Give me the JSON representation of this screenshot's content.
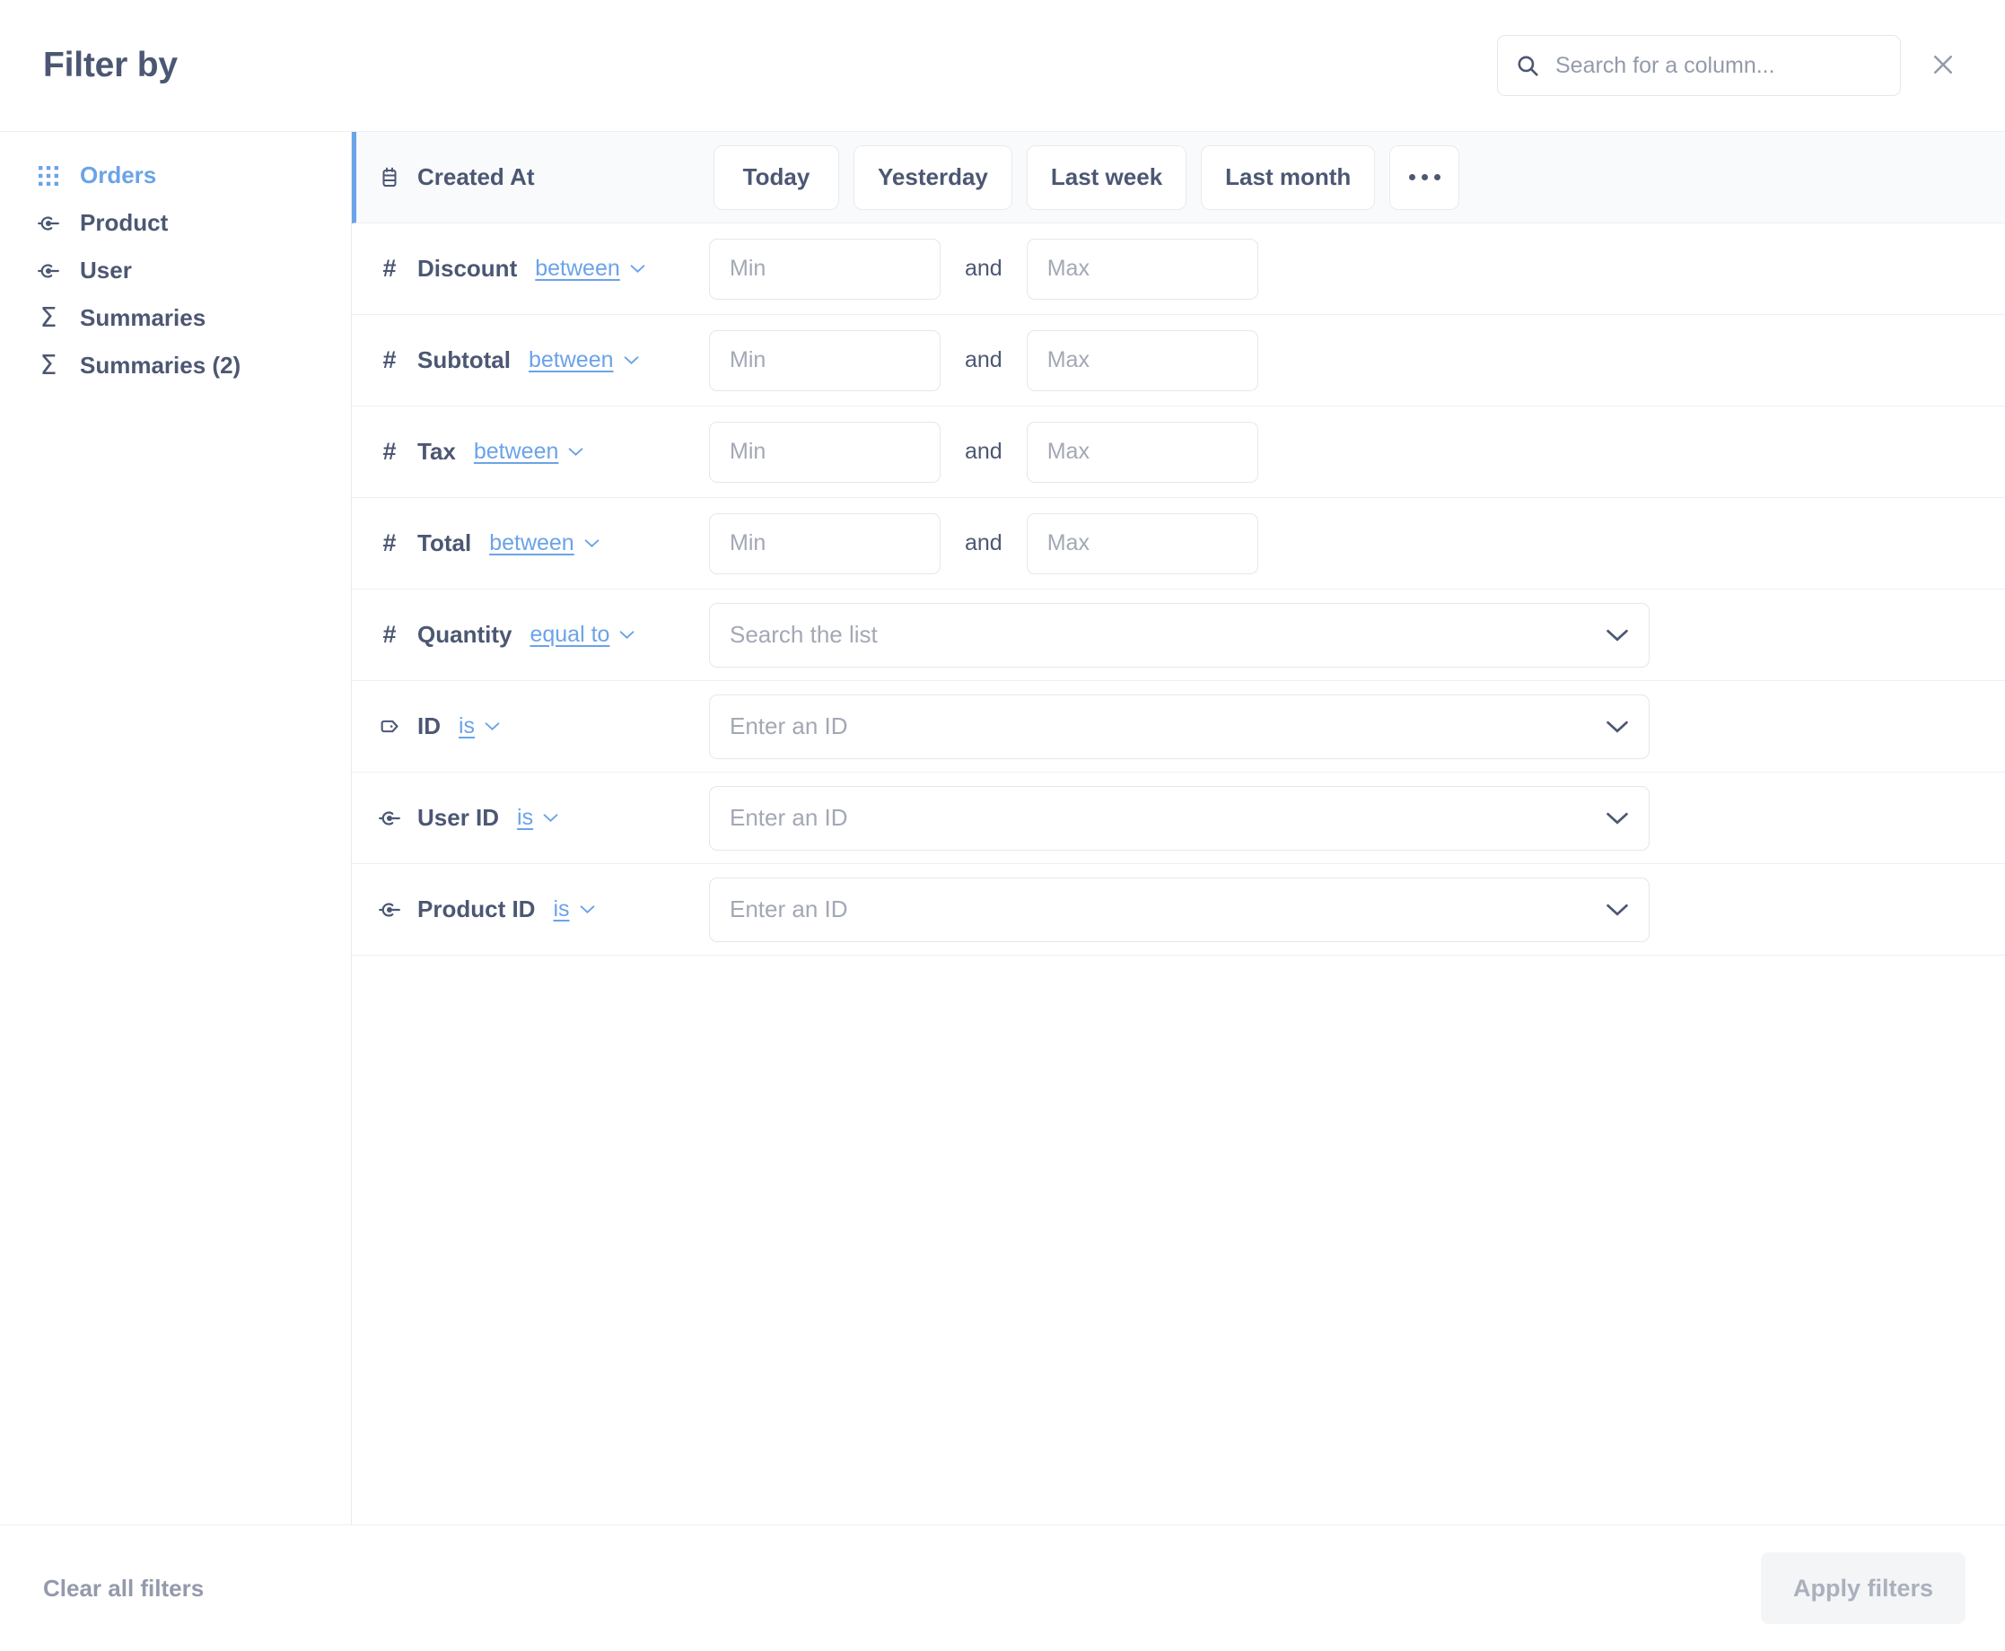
{
  "header": {
    "title": "Filter by",
    "search_placeholder": "Search for a column...",
    "search_value": "",
    "search_icon": "search-icon",
    "close_icon": "close-icon"
  },
  "sidebar": {
    "items": [
      {
        "label": "Orders",
        "icon": "table-grid-icon",
        "active": true
      },
      {
        "label": "Product",
        "icon": "foreign-key-icon",
        "active": false
      },
      {
        "label": "User",
        "icon": "foreign-key-icon",
        "active": false
      },
      {
        "label": "Summaries",
        "icon": "sigma-icon",
        "active": false
      },
      {
        "label": "Summaries (2)",
        "icon": "sigma-icon",
        "active": false
      }
    ]
  },
  "filters": {
    "rows": [
      {
        "name": "Created At",
        "icon": "calendar-icon",
        "kind": "date-shortcuts",
        "highlighted": true,
        "shortcuts": [
          "Today",
          "Yesterday",
          "Last week",
          "Last month"
        ],
        "more_label": "…"
      },
      {
        "name": "Discount",
        "icon": "number-icon",
        "kind": "between",
        "operator": "between",
        "min_placeholder": "Min",
        "max_placeholder": "Max",
        "conjunction": "and",
        "min_value": "",
        "max_value": ""
      },
      {
        "name": "Subtotal",
        "icon": "number-icon",
        "kind": "between",
        "operator": "between",
        "min_placeholder": "Min",
        "max_placeholder": "Max",
        "conjunction": "and",
        "min_value": "",
        "max_value": ""
      },
      {
        "name": "Tax",
        "icon": "number-icon",
        "kind": "between",
        "operator": "between",
        "min_placeholder": "Min",
        "max_placeholder": "Max",
        "conjunction": "and",
        "min_value": "",
        "max_value": ""
      },
      {
        "name": "Total",
        "icon": "number-icon",
        "kind": "between",
        "operator": "between",
        "min_placeholder": "Min",
        "max_placeholder": "Max",
        "conjunction": "and",
        "min_value": "",
        "max_value": ""
      },
      {
        "name": "Quantity",
        "icon": "number-icon",
        "kind": "select",
        "operator": "equal to",
        "select_placeholder": "Search the list",
        "select_value": ""
      },
      {
        "name": "ID",
        "icon": "entity-key-icon",
        "kind": "select",
        "operator": "is",
        "select_placeholder": "Enter an ID",
        "select_value": ""
      },
      {
        "name": "User ID",
        "icon": "foreign-key-icon",
        "kind": "select",
        "operator": "is",
        "select_placeholder": "Enter an ID",
        "select_value": ""
      },
      {
        "name": "Product ID",
        "icon": "foreign-key-icon",
        "kind": "select",
        "operator": "is",
        "select_placeholder": "Enter an ID",
        "select_value": ""
      }
    ]
  },
  "footer": {
    "clear_label": "Clear all filters",
    "apply_label": "Apply filters",
    "apply_disabled": true
  },
  "colors": {
    "accent_blue": "#6ba3e8",
    "text_primary": "#4c5773",
    "text_muted": "#949aab",
    "border": "#e3e7eb",
    "row_highlight_bg": "#f9fafb",
    "disabled_button_bg": "#f3f5f7"
  }
}
